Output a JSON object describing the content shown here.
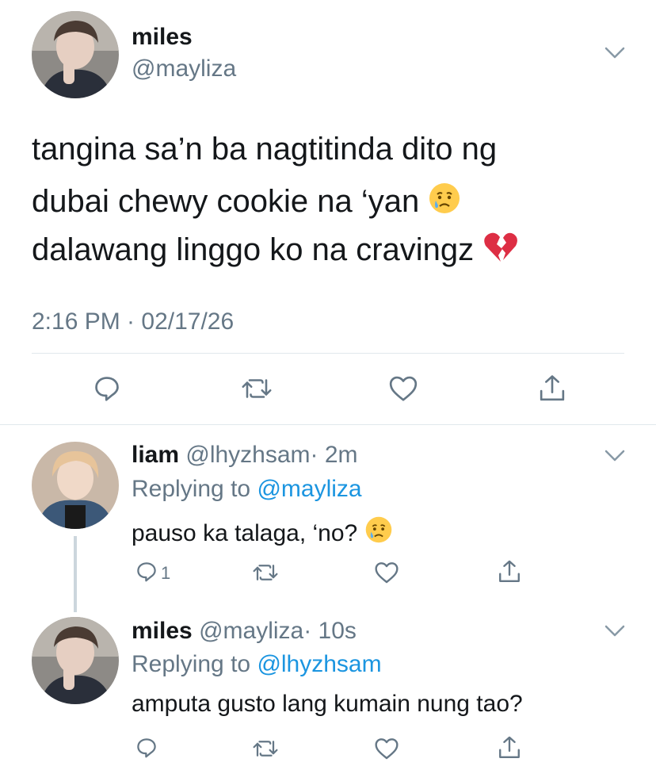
{
  "main_tweet": {
    "display_name": "miles",
    "handle": "@mayliza",
    "text_lines": [
      "tangina sa’n ba nagtitinda dito ng",
      "dubai chewy cookie na ‘yan",
      "dalawang linggo ko na cravingz"
    ],
    "emoji_line2": "crying-face-emoji",
    "emoji_line3": "broken-heart-emoji",
    "timestamp": "2:16 PM · 02/17/26",
    "actions": [
      "reply-icon",
      "retweet-icon",
      "like-icon",
      "share-icon"
    ]
  },
  "replies": [
    {
      "display_name": "liam",
      "handle": "@lhyzhsam",
      "time": "· 2m",
      "replying_label": "Replying to",
      "replying_to": "@mayliza",
      "text": "pauso ka talaga, ‘no?",
      "emoji": "crying-face-emoji",
      "reply_count": "1"
    },
    {
      "display_name": "miles",
      "handle": "@mayliza",
      "time": "· 10s",
      "replying_label": "Replying to",
      "replying_to": "@lhyzhsam",
      "text": "amputa gusto lang kumain nung tao?"
    }
  ],
  "colors": {
    "text": "#14171a",
    "muted": "#657786",
    "link": "#1b95e0",
    "divider": "#e1e8ed",
    "icon": "#657786"
  }
}
